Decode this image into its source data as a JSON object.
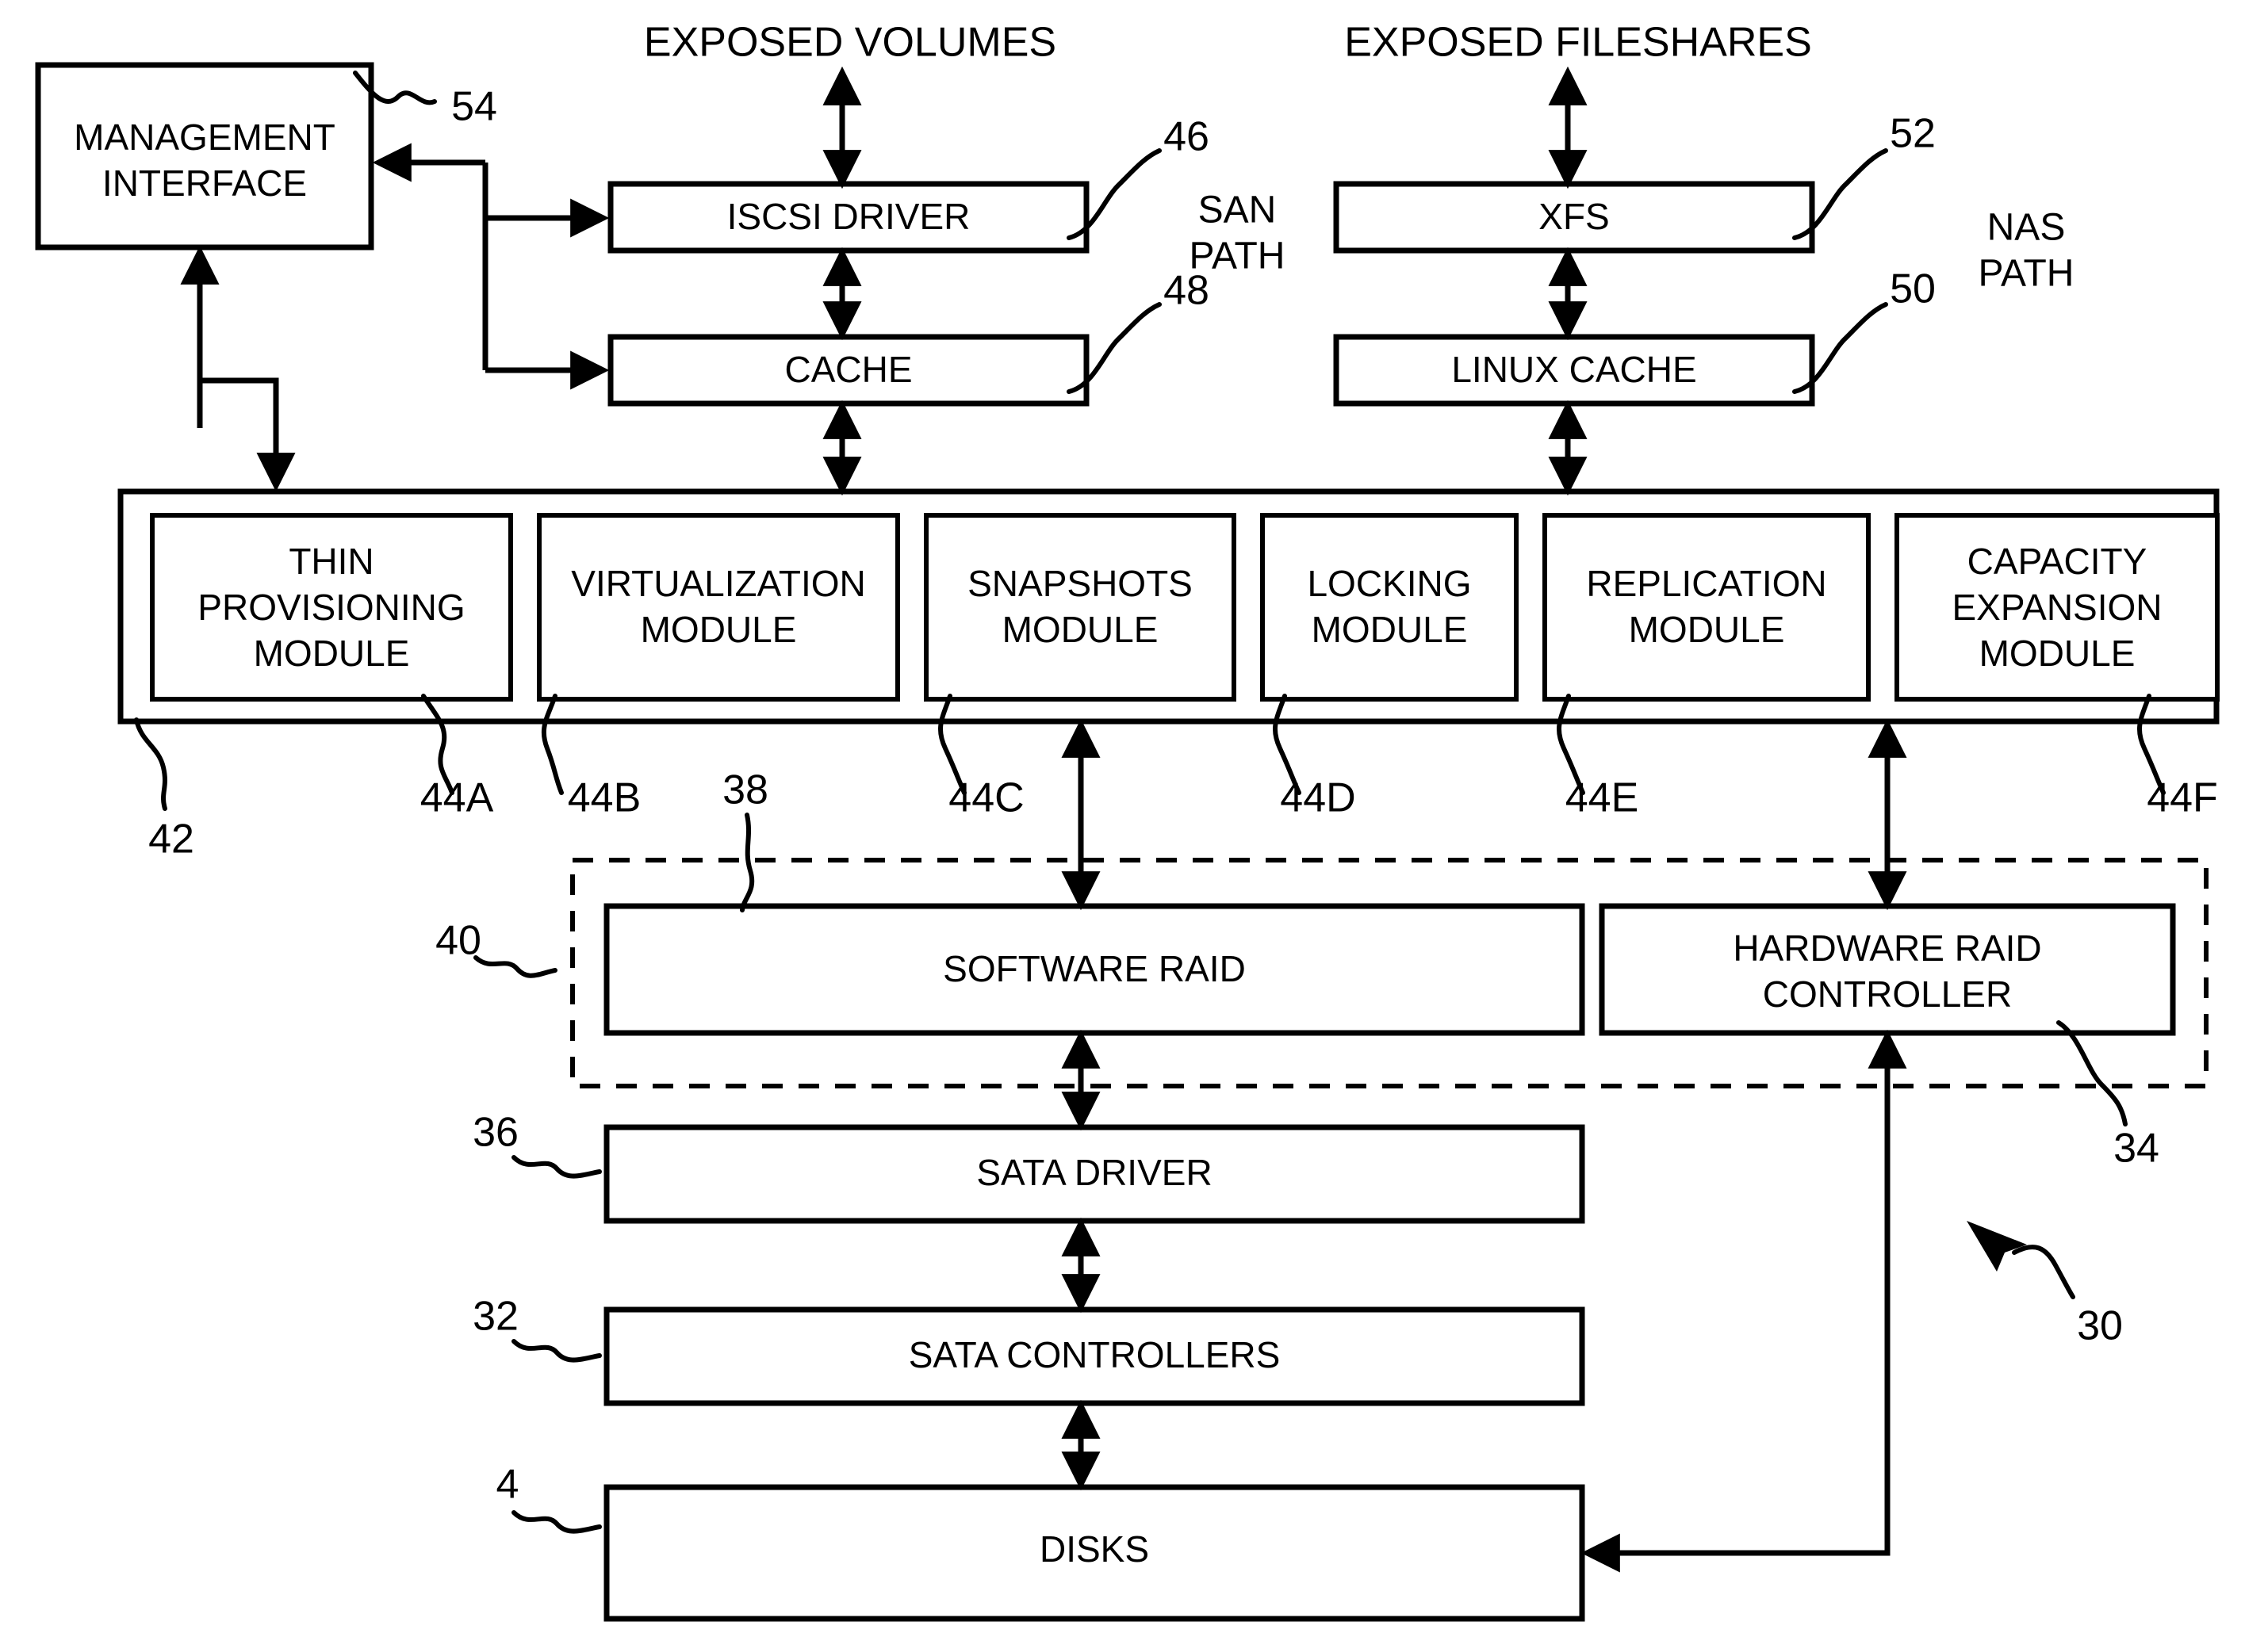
{
  "figure": {
    "title_texts": {
      "exposed_volumes": "EXPOSED VOLUMES",
      "exposed_fileshares": "EXPOSED FILESHARES",
      "san_path_line1": "SAN",
      "san_path_line2": "PATH",
      "nas_path_line1": "NAS",
      "nas_path_line2": "PATH"
    },
    "boxes": {
      "management_interface": {
        "line1": "MANAGEMENT",
        "line2": "INTERFACE",
        "ref": "54"
      },
      "iscsi_driver": {
        "label": "ISCSI DRIVER",
        "ref": "46"
      },
      "cache": {
        "label": "CACHE",
        "ref": "48"
      },
      "xfs": {
        "label": "XFS",
        "ref": "52"
      },
      "linux_cache": {
        "label": "LINUX CACHE",
        "ref": "50"
      },
      "software_raid": {
        "label": "SOFTWARE RAID",
        "ref": "38"
      },
      "hardware_raid_controller": {
        "line1": "HARDWARE RAID",
        "line2": "CONTROLLER",
        "ref": "34"
      },
      "sata_driver": {
        "label": "SATA DRIVER",
        "ref": "36"
      },
      "sata_controllers": {
        "label": "SATA CONTROLLERS",
        "ref": "32"
      },
      "disks": {
        "label": "DISKS",
        "ref": "4"
      },
      "module_container": {
        "ref": "42"
      },
      "raid_group": {
        "ref": "40"
      },
      "system": {
        "ref": "30"
      }
    },
    "modules": [
      {
        "lines": [
          "THIN",
          "PROVISIONING",
          "MODULE"
        ],
        "ref": "44A"
      },
      {
        "lines": [
          "VIRTUALIZATION",
          "MODULE"
        ],
        "ref": "44B"
      },
      {
        "lines": [
          "SNAPSHOTS",
          "MODULE"
        ],
        "ref": "44C"
      },
      {
        "lines": [
          "LOCKING",
          "MODULE"
        ],
        "ref": "44D"
      },
      {
        "lines": [
          "REPLICATION",
          "MODULE"
        ],
        "ref": "44E"
      },
      {
        "lines": [
          "CAPACITY",
          "EXPANSION",
          "MODULE"
        ],
        "ref": "44F"
      }
    ],
    "colors": {
      "ink": "#000000",
      "paper": "#ffffff"
    }
  }
}
